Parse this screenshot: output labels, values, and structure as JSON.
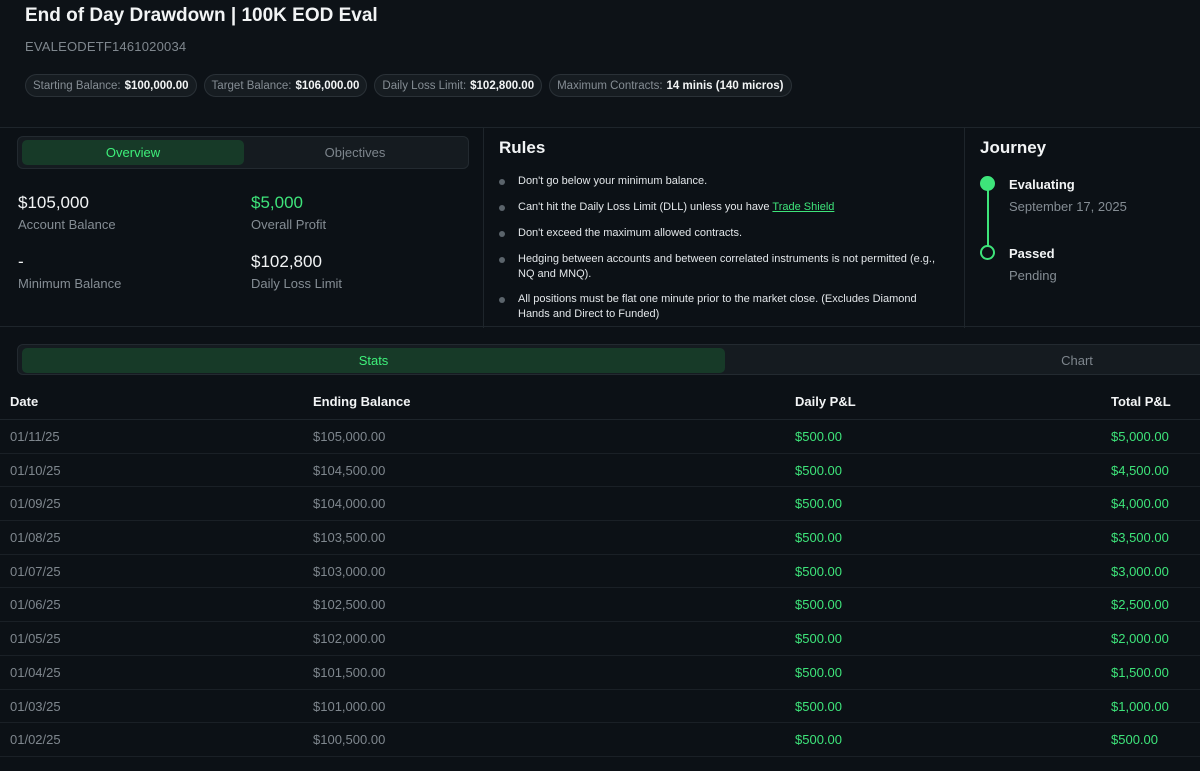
{
  "header": {
    "title": "End of Day Drawdown | 100K EOD Eval",
    "account_id": "EVALEODETF1461020034",
    "chips": [
      {
        "label": "Starting Balance:",
        "value": "$100,000.00"
      },
      {
        "label": "Target Balance:",
        "value": "$106,000.00"
      },
      {
        "label": "Daily Loss Limit:",
        "value": "$102,800.00"
      },
      {
        "label": "Maximum Contracts:",
        "value": "14 minis (140 micros)"
      }
    ]
  },
  "overview": {
    "tabs": {
      "overview": "Overview",
      "objectives": "Objectives"
    },
    "account_balance": {
      "value": "$105,000",
      "label": "Account Balance"
    },
    "overall_profit": {
      "value": "$5,000",
      "label": "Overall Profit"
    },
    "minimum_balance": {
      "value": "-",
      "label": "Minimum Balance"
    },
    "daily_loss_limit": {
      "value": "$102,800",
      "label": "Daily Loss Limit"
    }
  },
  "rules": {
    "heading": "Rules",
    "items": [
      "Don't go below your minimum balance.",
      "Can't hit the Daily Loss Limit (DLL) unless you have",
      "Don't exceed the maximum allowed contracts.",
      "Hedging between accounts and between correlated instruments is not permitted (e.g., NQ and MNQ).",
      "All positions must be flat one minute prior to the market close. (Excludes Diamond Hands and Direct to Funded)"
    ],
    "trade_shield_link": "Trade Shield"
  },
  "journey": {
    "heading": "Journey",
    "steps": [
      {
        "title": "Evaluating",
        "subtitle": "September 17, 2025"
      },
      {
        "title": "Passed",
        "subtitle": "Pending"
      }
    ]
  },
  "stats": {
    "tabs": {
      "stats": "Stats",
      "chart": "Chart"
    },
    "columns": [
      "Date",
      "Ending Balance",
      "Daily P&L",
      "Total P&L"
    ],
    "rows": [
      [
        "01/11/25",
        "$105,000.00",
        "$500.00",
        "$5,000.00"
      ],
      [
        "01/10/25",
        "$104,500.00",
        "$500.00",
        "$4,500.00"
      ],
      [
        "01/09/25",
        "$104,000.00",
        "$500.00",
        "$4,000.00"
      ],
      [
        "01/08/25",
        "$103,500.00",
        "$500.00",
        "$3,500.00"
      ],
      [
        "01/07/25",
        "$103,000.00",
        "$500.00",
        "$3,000.00"
      ],
      [
        "01/06/25",
        "$102,500.00",
        "$500.00",
        "$2,500.00"
      ],
      [
        "01/05/25",
        "$102,000.00",
        "$500.00",
        "$2,000.00"
      ],
      [
        "01/04/25",
        "$101,500.00",
        "$500.00",
        "$1,500.00"
      ],
      [
        "01/03/25",
        "$101,000.00",
        "$500.00",
        "$1,000.00"
      ],
      [
        "01/02/25",
        "$100,500.00",
        "$500.00",
        "$500.00"
      ]
    ]
  },
  "colors": {
    "background": "#0c1116",
    "accent_green": "#3ee47a",
    "active_tab_bg": "#173a28",
    "muted_text": "#858d94"
  }
}
